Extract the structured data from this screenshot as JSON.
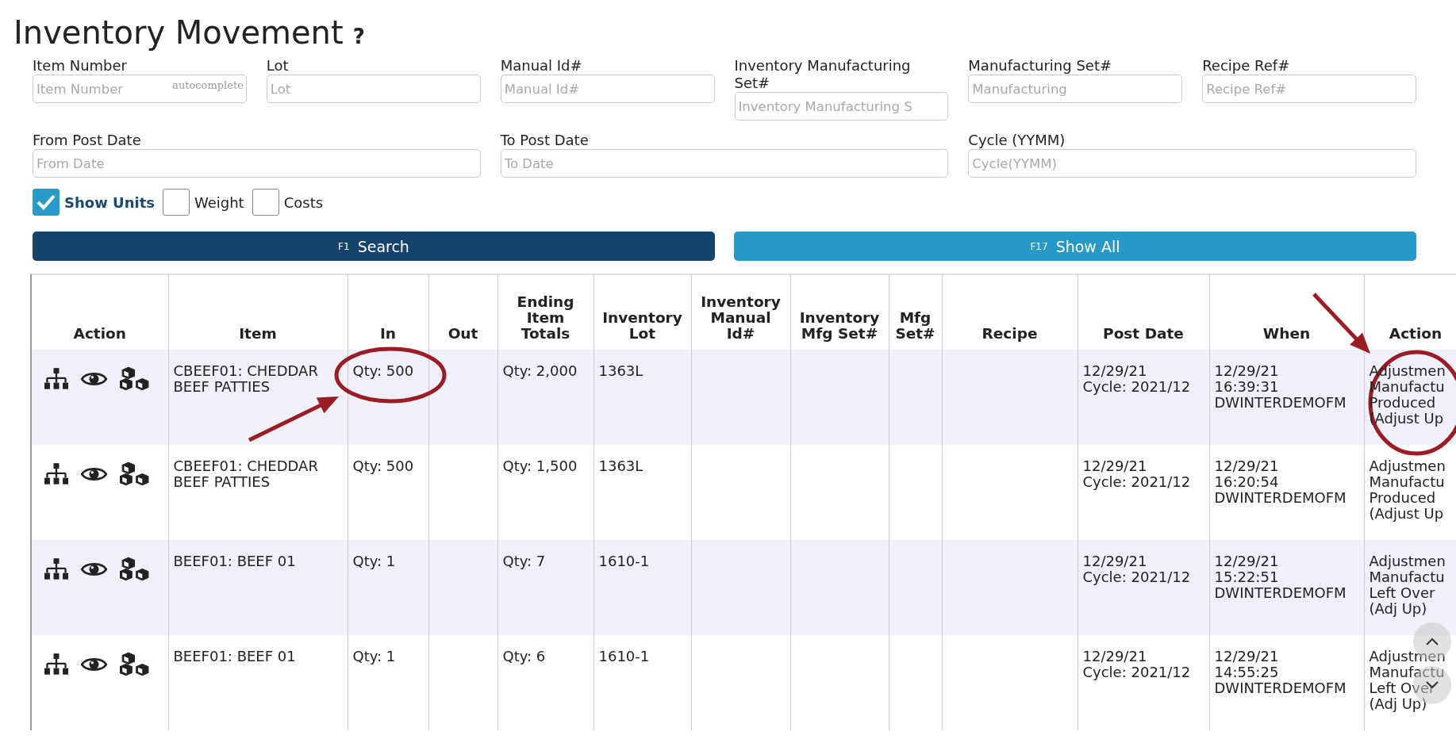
{
  "page": {
    "title": "Inventory Movement",
    "help": "?"
  },
  "filter_rows": [
    [
      {
        "label": "Item Number",
        "placeholder": "Item Number",
        "suffix": "autocomplete"
      },
      {
        "label": "Lot",
        "placeholder": "Lot"
      },
      {
        "label": "Manual Id#",
        "placeholder": "Manual Id#"
      },
      {
        "label": "Inventory Manufacturing Set#",
        "placeholder": "Inventory Manufacturing S"
      },
      {
        "label": "Manufacturing Set#",
        "placeholder": "Manufacturing"
      },
      {
        "label": "Recipe Ref#",
        "placeholder": "Recipe Ref#"
      }
    ],
    [
      {
        "label": "From Post Date",
        "placeholder": "From Date"
      },
      {
        "label": "To Post Date",
        "placeholder": "To Date"
      },
      {
        "label": "Cycle (YYMM)",
        "placeholder": "Cycle(YYMM)"
      }
    ]
  ],
  "options": [
    {
      "label": "Show Units",
      "checked": true
    },
    {
      "label": "Weight",
      "checked": false
    },
    {
      "label": "Costs",
      "checked": false
    }
  ],
  "buttons": [
    {
      "key": "F1",
      "label": "Search",
      "kind": "primary"
    },
    {
      "key": "F17",
      "label": "Show All",
      "kind": "secondary"
    }
  ],
  "table": {
    "columns": [
      "Action",
      "Item",
      "In",
      "Out",
      "Ending Item Totals",
      "Inventory Lot",
      "Inventory Manual Id#",
      "Inventory Mfg Set#",
      "Mfg Set#",
      "Recipe",
      "Post Date",
      "When",
      "Action"
    ],
    "rows": [
      {
        "item": "CBEEF01: CHEDDAR BEEF PATTIES",
        "in": "Qty: 500",
        "ending": "Qty: 2,000",
        "lot": "1363L",
        "post_date": "12/29/21\nCycle: 2021/12",
        "when": "12/29/21\n16:39:31\nDWINTERDEMOFM",
        "action": "Adjustmen\nManufactu\nProduced\n(Adjust Up"
      },
      {
        "item": "CBEEF01: CHEDDAR BEEF PATTIES",
        "in": "Qty: 500",
        "ending": "Qty: 1,500",
        "lot": "1363L",
        "post_date": "12/29/21\nCycle: 2021/12",
        "when": "12/29/21\n16:20:54\nDWINTERDEMOFM",
        "action": "Adjustmen\nManufactu\nProduced\n(Adjust Up"
      },
      {
        "item": "BEEF01: BEEF 01",
        "in": "Qty: 1",
        "ending": "Qty: 7",
        "lot": "1610-1",
        "post_date": "12/29/21\nCycle: 2021/12",
        "when": "12/29/21\n15:22:51\nDWINTERDEMOFM",
        "action": "Adjustmen\nManufactu\nLeft Over\n(Adj Up)"
      },
      {
        "item": "BEEF01: BEEF 01",
        "in": "Qty: 1",
        "ending": "Qty: 6",
        "lot": "1610-1",
        "post_date": "12/29/21\nCycle: 2021/12",
        "when": "12/29/21\n14:55:25\nDWINTERDEMOFM",
        "action": "Adjustmen\nManufactu\nLeft Over\n(Adj Up)"
      }
    ]
  }
}
